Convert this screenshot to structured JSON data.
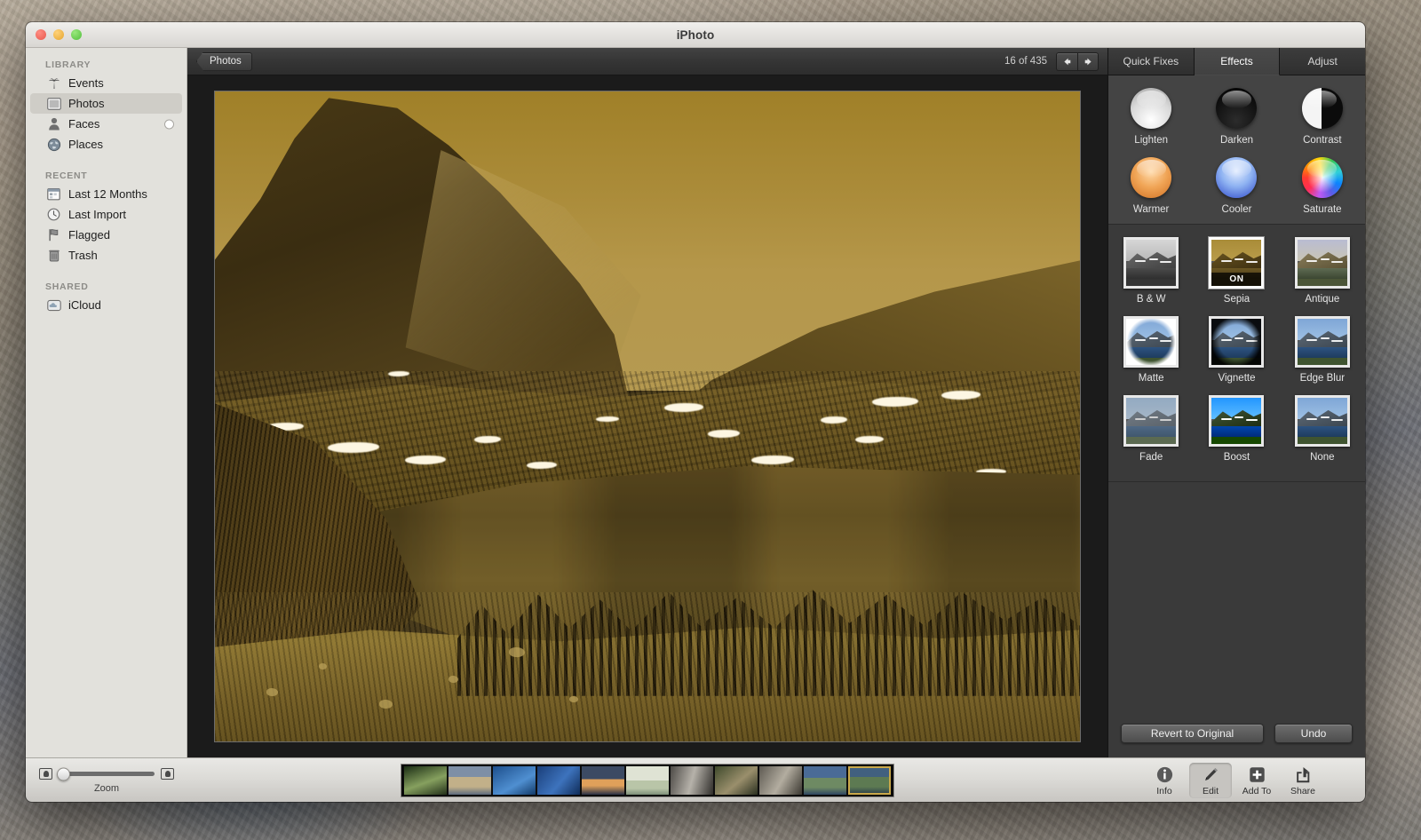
{
  "window": {
    "title": "iPhoto",
    "traffic_lights": [
      "close",
      "minimize",
      "zoom"
    ]
  },
  "sidebar": {
    "sections": [
      {
        "header": "LIBRARY",
        "items": [
          {
            "label": "Events",
            "icon": "palm-tree-icon",
            "selected": false
          },
          {
            "label": "Photos",
            "icon": "photo-icon",
            "selected": true
          },
          {
            "label": "Faces",
            "icon": "person-icon",
            "selected": false,
            "badge": "dot"
          },
          {
            "label": "Places",
            "icon": "globe-icon",
            "selected": false
          }
        ]
      },
      {
        "header": "RECENT",
        "items": [
          {
            "label": "Last 12 Months",
            "icon": "calendar-icon",
            "selected": false
          },
          {
            "label": "Last Import",
            "icon": "clock-icon",
            "selected": false
          },
          {
            "label": "Flagged",
            "icon": "flag-icon",
            "selected": false
          },
          {
            "label": "Trash",
            "icon": "trash-icon",
            "selected": false
          }
        ]
      },
      {
        "header": "SHARED",
        "items": [
          {
            "label": "iCloud",
            "icon": "cloud-icon",
            "selected": false
          }
        ]
      }
    ]
  },
  "toolbar": {
    "back_label": "Photos",
    "counter": "16 of 435",
    "prev_icon": "arrow-left-icon",
    "next_icon": "arrow-right-icon"
  },
  "right_panel": {
    "tabs": [
      {
        "label": "Quick Fixes",
        "active": false
      },
      {
        "label": "Effects",
        "active": true
      },
      {
        "label": "Adjust",
        "active": false
      }
    ],
    "quick_effects": [
      {
        "label": "Lighten",
        "orb": "orb-lighten"
      },
      {
        "label": "Darken",
        "orb": "orb-darken"
      },
      {
        "label": "Contrast",
        "orb": "orb-contrast"
      },
      {
        "label": "Warmer",
        "orb": "orb-warmer"
      },
      {
        "label": "Cooler",
        "orb": "orb-cooler"
      },
      {
        "label": "Saturate",
        "orb": "orb-saturate"
      }
    ],
    "presets": [
      {
        "label": "B & W",
        "on": false,
        "style": "bw"
      },
      {
        "label": "Sepia",
        "on": true,
        "on_badge": "ON",
        "style": "sepia"
      },
      {
        "label": "Antique",
        "on": false,
        "style": "antique"
      },
      {
        "label": "Matte",
        "on": false,
        "style": "matte"
      },
      {
        "label": "Vignette",
        "on": false,
        "style": "vignette"
      },
      {
        "label": "Edge Blur",
        "on": false,
        "style": "edgeblur"
      },
      {
        "label": "Fade",
        "on": false,
        "style": "fade"
      },
      {
        "label": "Boost",
        "on": false,
        "style": "boost"
      },
      {
        "label": "None",
        "on": false,
        "style": "none"
      }
    ],
    "actions": {
      "revert_label": "Revert to Original",
      "undo_label": "Undo"
    }
  },
  "bottom_bar": {
    "zoom_label": "Zoom",
    "zoom_value": 0,
    "zoom_min_icon": "small-photo-icon",
    "zoom_max_icon": "large-photo-icon",
    "tools": [
      {
        "label": "Info",
        "icon": "info-icon",
        "active": false
      },
      {
        "label": "Edit",
        "icon": "pencil-icon",
        "active": true
      },
      {
        "label": "Add To",
        "icon": "plus-icon",
        "active": false
      },
      {
        "label": "Share",
        "icon": "share-icon",
        "active": false
      }
    ],
    "filmstrip": [
      {
        "name": "waterfall-forest",
        "selected": false,
        "c1": "#1b2d14",
        "c2": "#86a05f",
        "c3": "#23301a"
      },
      {
        "name": "coastal-dunes",
        "selected": false,
        "c1": "#7e8fa6",
        "c2": "#c2b089",
        "c3": "#5d6b7e"
      },
      {
        "name": "blue-water-ripples",
        "selected": false,
        "c1": "#1d4f8c",
        "c2": "#4f8fd1",
        "c3": "#123a68"
      },
      {
        "name": "deep-blue-wave",
        "selected": false,
        "c1": "#1a3f7a",
        "c2": "#3d73bd",
        "c3": "#0f2c58"
      },
      {
        "name": "sunset-clouds",
        "selected": false,
        "c1": "#3c4a63",
        "c2": "#e0a05a",
        "c3": "#2a3146"
      },
      {
        "name": "pale-sea-horizon",
        "selected": false,
        "c1": "#dfe3d4",
        "c2": "#b9c5a8",
        "c3": "#7e8f79"
      },
      {
        "name": "canyon-waterfall",
        "selected": false,
        "c1": "#4d4a46",
        "c2": "#b6b2aa",
        "c3": "#2f2d2a"
      },
      {
        "name": "river-rocks",
        "selected": false,
        "c1": "#3f4a2c",
        "c2": "#9a8f6c",
        "c3": "#2a3020"
      },
      {
        "name": "stream-boulders",
        "selected": false,
        "c1": "#5e5a52",
        "c2": "#b3ada0",
        "c3": "#3a3730"
      },
      {
        "name": "mountain-lake-wide",
        "selected": false,
        "c1": "#4a6b96",
        "c2": "#6e8a63",
        "c3": "#2f4662"
      },
      {
        "name": "hidden-lake-current",
        "selected": true,
        "c1": "#41607f",
        "c2": "#5d7a52",
        "c3": "#27384a"
      }
    ]
  },
  "main_photo": {
    "name": "hidden-lake-sepia",
    "effect_applied": "Sepia",
    "alt": "Sepia-toned mountain peak above an alpine lake with snow patches and conifer forest"
  }
}
